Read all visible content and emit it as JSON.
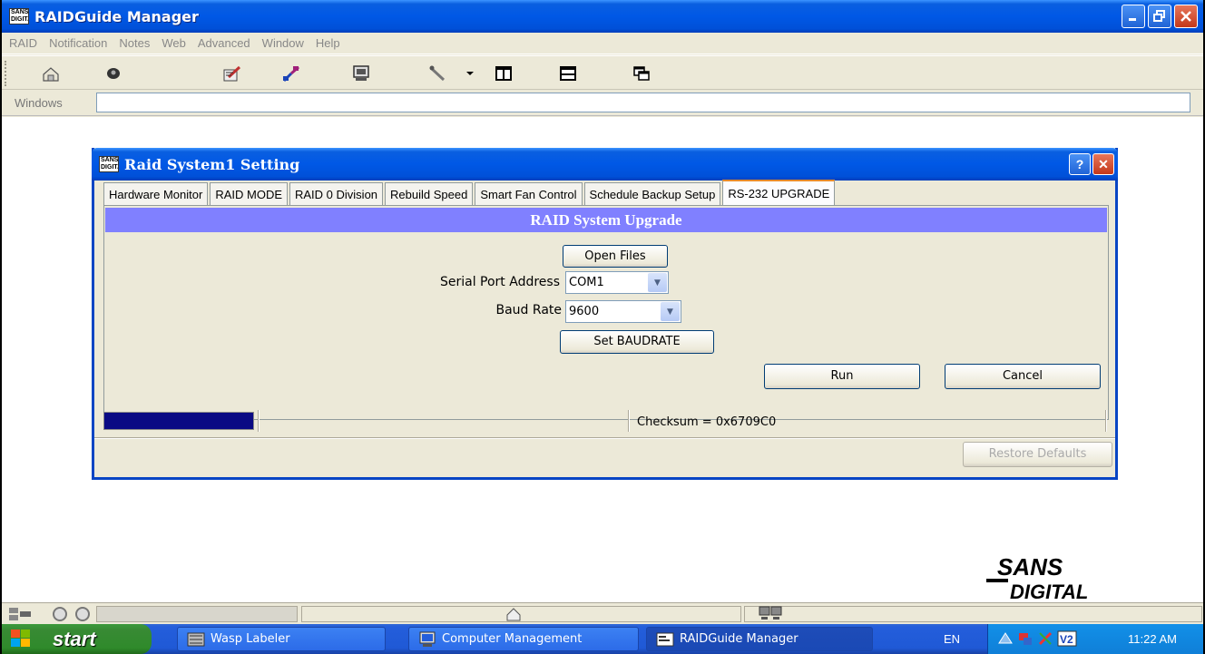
{
  "app": {
    "title": "RAIDGuide Manager",
    "icon_text": "SANS DIGITAL"
  },
  "menu": [
    "RAID",
    "Notification",
    "Notes",
    "Web",
    "Advanced",
    "Window",
    "Help"
  ],
  "toolbar_icons": [
    "home-icon",
    "eye-icon",
    "edit-icon",
    "connect-icon",
    "monitor-icon",
    "tools-icon",
    "dropdown-arrow-icon",
    "tile-vertical-icon",
    "tile-horizontal-icon",
    "cascade-icon"
  ],
  "windows_bar": {
    "label": "Windows",
    "value": ""
  },
  "dialog": {
    "title": "Raid System1 Setting",
    "help_label": "?",
    "close_label": "✕",
    "tabs": [
      "Hardware Monitor",
      "RAID MODE",
      "RAID 0 Division",
      "Rebuild Speed",
      "Smart Fan Control",
      "Schedule Backup Setup",
      "RS-232 UPGRADE"
    ],
    "active_tab": "RS-232 UPGRADE",
    "banner": "RAID System Upgrade",
    "open_files": "Open Files",
    "serial_label": "Serial Port Address",
    "serial_value": "COM1",
    "baud_label": "Baud Rate",
    "baud_value": "9600",
    "set_baud": "Set BAUDRATE",
    "run": "Run",
    "cancel": "Cancel",
    "progress_fraction": 1.0,
    "checksum": "Checksum = 0x6709C0",
    "restore": "Restore Defaults"
  },
  "logo": {
    "line1": "SANS",
    "line2": "DIGITAL"
  },
  "taskbar": {
    "start": "start",
    "tasks": [
      "Wasp Labeler",
      "Computer Management",
      "RAIDGuide Manager"
    ],
    "language": "EN",
    "clock": "11:22 AM"
  },
  "colors": {
    "banner": "#8080ff",
    "titlebar": "#0058e6",
    "progress": "#0a0a84"
  }
}
